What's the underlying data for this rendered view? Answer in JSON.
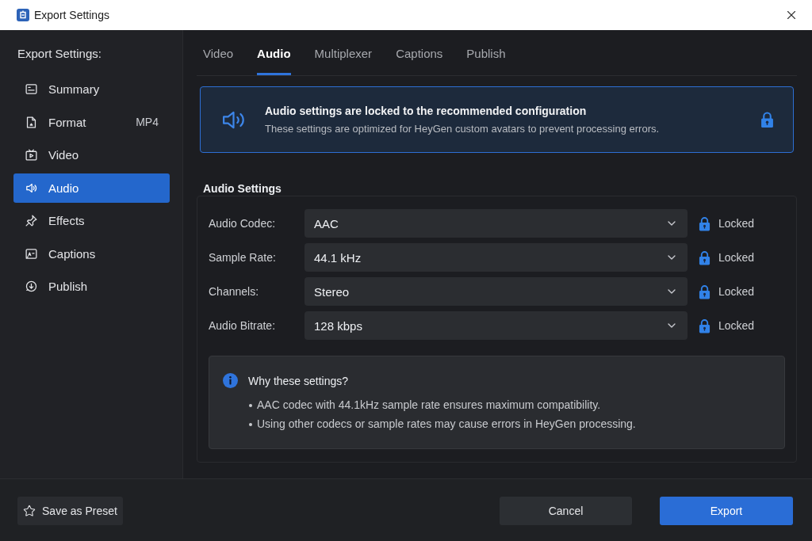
{
  "window": {
    "title": "Export Settings"
  },
  "sidebar": {
    "heading": "Export Settings:",
    "items": [
      {
        "label": "Summary",
        "selected": false
      },
      {
        "label": "Format",
        "value": "MP4",
        "selected": false
      },
      {
        "label": "Video",
        "selected": false
      },
      {
        "label": "Audio",
        "selected": true
      },
      {
        "label": "Effects",
        "selected": false
      },
      {
        "label": "Captions",
        "selected": false
      },
      {
        "label": "Publish",
        "selected": false
      }
    ]
  },
  "tabs": [
    {
      "label": "Video",
      "selected": false
    },
    {
      "label": "Audio",
      "selected": true
    },
    {
      "label": "Multiplexer",
      "selected": false
    },
    {
      "label": "Captions",
      "selected": false
    },
    {
      "label": "Publish",
      "selected": false
    }
  ],
  "banner": {
    "title": "Audio settings are locked to the recommended configuration",
    "text": "These settings are optimized for HeyGen custom avatars to prevent processing errors."
  },
  "audio_settings": {
    "title": "Audio Settings",
    "rows": [
      {
        "label": "Audio Codec:",
        "value": "AAC",
        "status": "Locked"
      },
      {
        "label": "Sample Rate:",
        "value": "44.1 kHz",
        "status": "Locked"
      },
      {
        "label": "Channels:",
        "value": "Stereo",
        "status": "Locked"
      },
      {
        "label": "Audio Bitrate:",
        "value": "128 kbps",
        "status": "Locked"
      }
    ],
    "info": {
      "title": "Why these settings?",
      "bullets": [
        "AAC codec with 44.1kHz sample rate ensures maximum compatibility.",
        "Using other codecs or sample rates may cause errors in HeyGen processing."
      ]
    }
  },
  "footer": {
    "buttons": [
      {
        "label": "Save as Preset",
        "kind": "preset"
      },
      {
        "label": "Cancel",
        "kind": "secondary"
      },
      {
        "label": "Export",
        "kind": "primary"
      }
    ]
  }
}
